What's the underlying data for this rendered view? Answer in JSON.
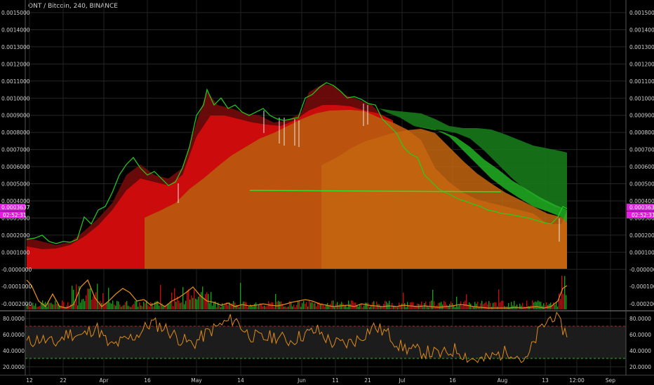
{
  "header": {
    "title": "ONT / Bitcoin, 240, BINANCE"
  },
  "colors": {
    "background": "#000000",
    "grid": "#2a2a2a",
    "price_red": "#d60f0f",
    "price_dark_red": "#7a0c0c",
    "price_orange": "#c25b10",
    "price_green": "#1fbf1f",
    "price_dark_green": "#1a7a1a",
    "volume_red": "#c40c0c",
    "volume_green": "#1a9c1a",
    "rsi_line": "#e08a1a",
    "badge": "#e020e0"
  },
  "price_axis": {
    "labels": [
      "0.0015000",
      "0.0014000",
      "0.0013000",
      "0.0012000",
      "0.0011000",
      "0.0010000",
      "0.0009000",
      "0.0008000",
      "0.0007000",
      "0.0006000",
      "0.0005000",
      "0.0004000",
      "0.0003000",
      "0.0002000",
      "0.0001000",
      "-0.0000000"
    ],
    "min": 0,
    "max": 0.0015,
    "current_badge_left": "0.0003637",
    "current_badge_right": "0.0003637",
    "countdown_left": "02:52:31",
    "countdown_right": "02:52:31"
  },
  "volume_axis": {
    "labels": [
      "-0.0001000",
      "-0.0002000"
    ],
    "top_label": "-0.0000000"
  },
  "rsi_axis": {
    "labels": [
      "80.0000",
      "60.0000",
      "40.0000",
      "20.0000"
    ],
    "upper": 70,
    "lower": 30
  },
  "time_axis": {
    "labels": [
      "12",
      "22",
      "Apr",
      "16",
      "May",
      "14",
      "Jun",
      "11",
      "21",
      "Jul",
      "16",
      "Aug",
      "13",
      "12:00",
      "Sep"
    ]
  },
  "chart_data": {
    "type": "area",
    "title": "ONT / Bitcoin, 240, BINANCE",
    "x_ticks": [
      "12",
      "22",
      "Apr",
      "16",
      "May",
      "14",
      "Jun",
      "11",
      "21",
      "Jul",
      "16",
      "Aug",
      "13",
      "12:00",
      "Sep"
    ],
    "ylim": [
      0,
      0.0015
    ],
    "series": [
      {
        "name": "",
        "values": [
          0.00018,
          0.00016,
          0.00015,
          0.00015,
          0.00017,
          0.00022,
          0.0003,
          0.00038,
          0.0005,
          0.0006,
          0.00052,
          0.00048,
          0.0005,
          0.00055,
          0.00095,
          0.00102,
          0.00094,
          0.0009,
          0.00093,
          0.00088,
          0.0009,
          0.00095,
          0.00105,
          0.0011,
          0.001,
          0.00098,
          0.00095,
          0.0009,
          0.0008,
          0.00065,
          0.0005,
          0.00042,
          0.00035,
          0.00032,
          0.0003,
          0.00028,
          0.00022,
          0.00036
        ]
      }
    ],
    "rsi_values": [
      50,
      55,
      48,
      62,
      58,
      70,
      45,
      52,
      60,
      75,
      68,
      55,
      48,
      62,
      72,
      80,
      60,
      55,
      58,
      52,
      60,
      65,
      50,
      48,
      55,
      70,
      62,
      45,
      40,
      38,
      35,
      42,
      30,
      28,
      35,
      40,
      25,
      65,
      85,
      60
    ]
  }
}
